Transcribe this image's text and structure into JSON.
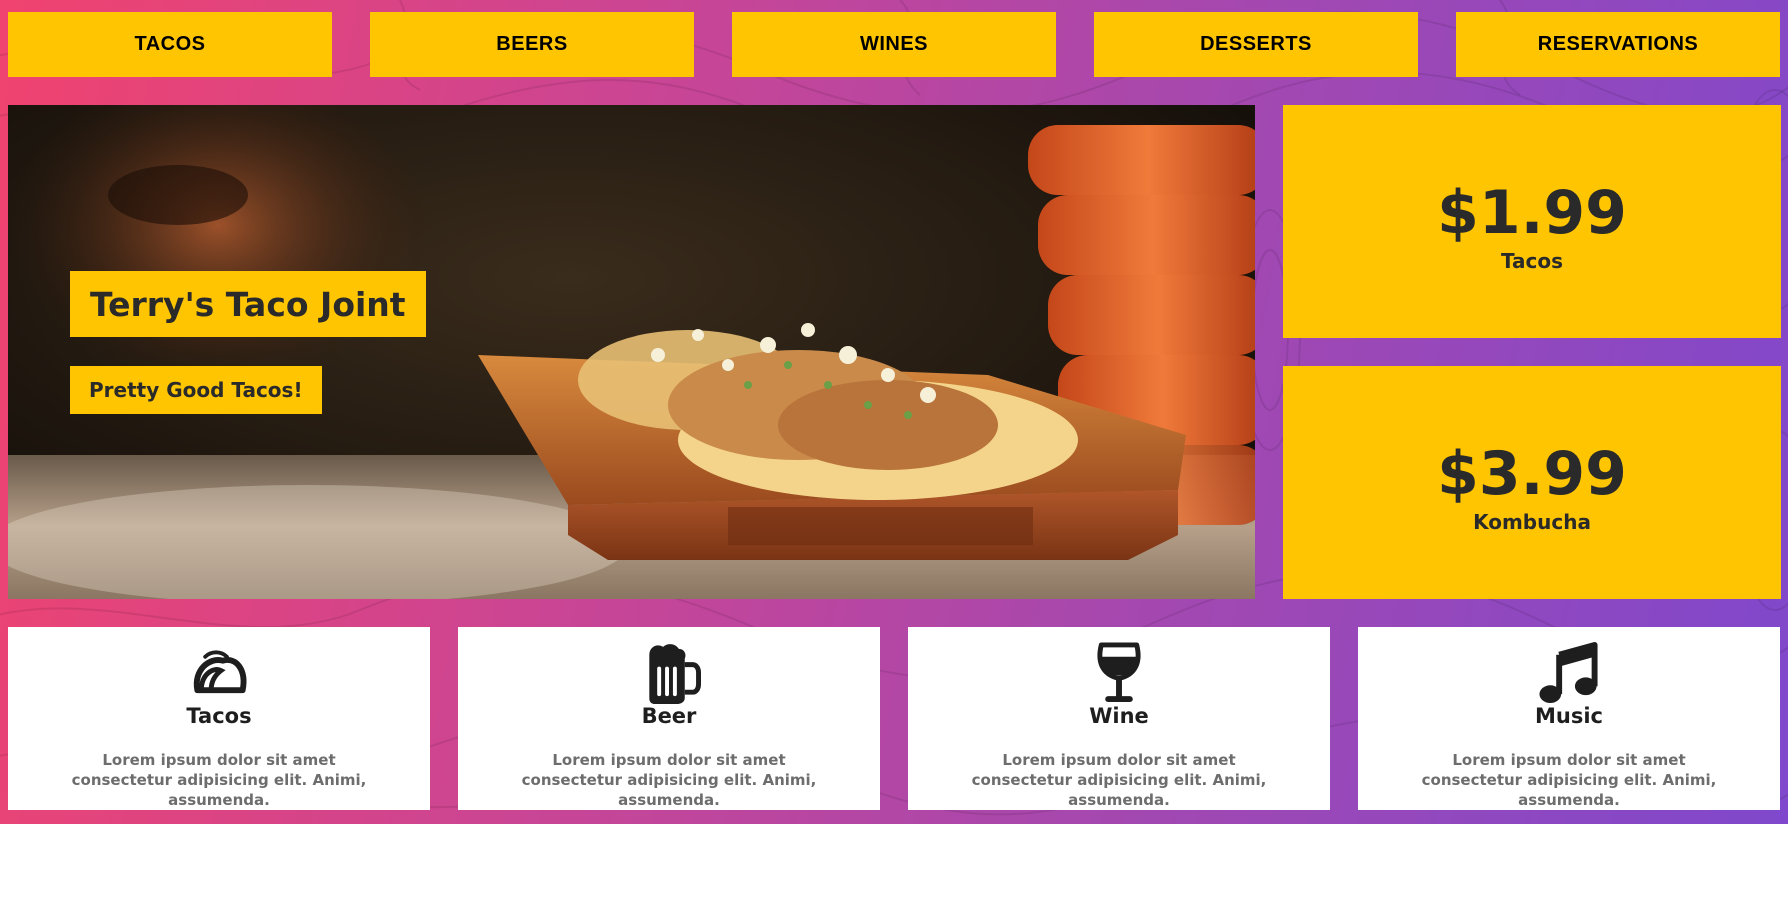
{
  "nav": {
    "items": [
      "TACOS",
      "BEERS",
      "WINES",
      "DESSERTS",
      "RESERVATIONS"
    ]
  },
  "hero": {
    "title": "Terry's Taco Joint",
    "subtitle": "Pretty Good Tacos!"
  },
  "prices": [
    {
      "amount": "$1.99",
      "label": "Tacos"
    },
    {
      "amount": "$3.99",
      "label": "Kombucha"
    }
  ],
  "features": [
    {
      "icon": "taco-icon",
      "title": "Tacos",
      "text": "Lorem ipsum dolor sit amet consectetur adipisicing elit. Animi, assumenda."
    },
    {
      "icon": "beer-mug-icon",
      "title": "Beer",
      "text": "Lorem ipsum dolor sit amet consectetur adipisicing elit. Animi, assumenda."
    },
    {
      "icon": "wine-glass-icon",
      "title": "Wine",
      "text": "Lorem ipsum dolor sit amet consectetur adipisicing elit. Animi, assumenda."
    },
    {
      "icon": "music-note-icon",
      "title": "Music",
      "text": "Lorem ipsum dolor sit amet consectetur adipisicing elit. Animi, assumenda."
    }
  ],
  "colors": {
    "accent": "#ffc500",
    "gradient_start": "#f0436f",
    "gradient_end": "#7f48cc",
    "text_dark": "#2a2a2a",
    "text_muted": "#6d6d6d"
  }
}
